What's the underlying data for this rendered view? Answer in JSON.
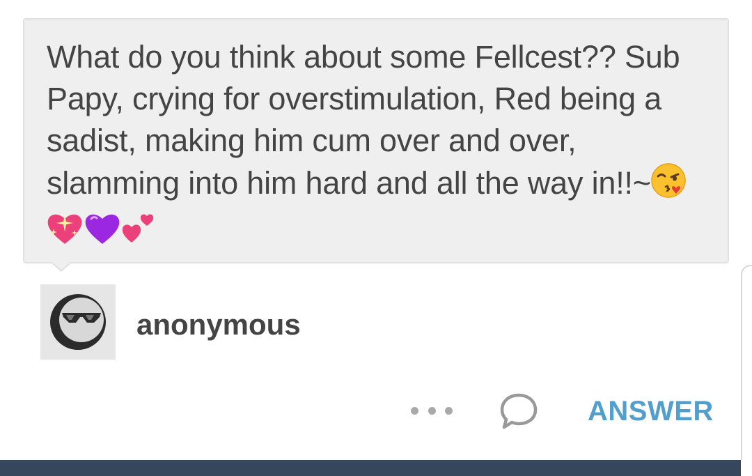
{
  "ask": {
    "text": "What do you think about some Fellcest?? Sub Papy, crying for overstimulation, Red being a sadist, making him cum over and over, slamming into him hard and all the way in!!~",
    "emojis": [
      "kissing-face-wink-emoji",
      "sparkling-heart-emoji",
      "purple-heart-emoji",
      "two-hearts-emoji"
    ]
  },
  "asker": {
    "name": "anonymous",
    "avatar_icon": "sunglasses-avatar-icon"
  },
  "actions": {
    "more_icon": "ellipsis-icon",
    "reply_icon": "comment-bubble-icon",
    "answer_label": "ANSWER"
  },
  "colors": {
    "bubble_bg": "#efefef",
    "text": "#444444",
    "accent": "#529ecc",
    "nav_bar": "#36465d"
  }
}
